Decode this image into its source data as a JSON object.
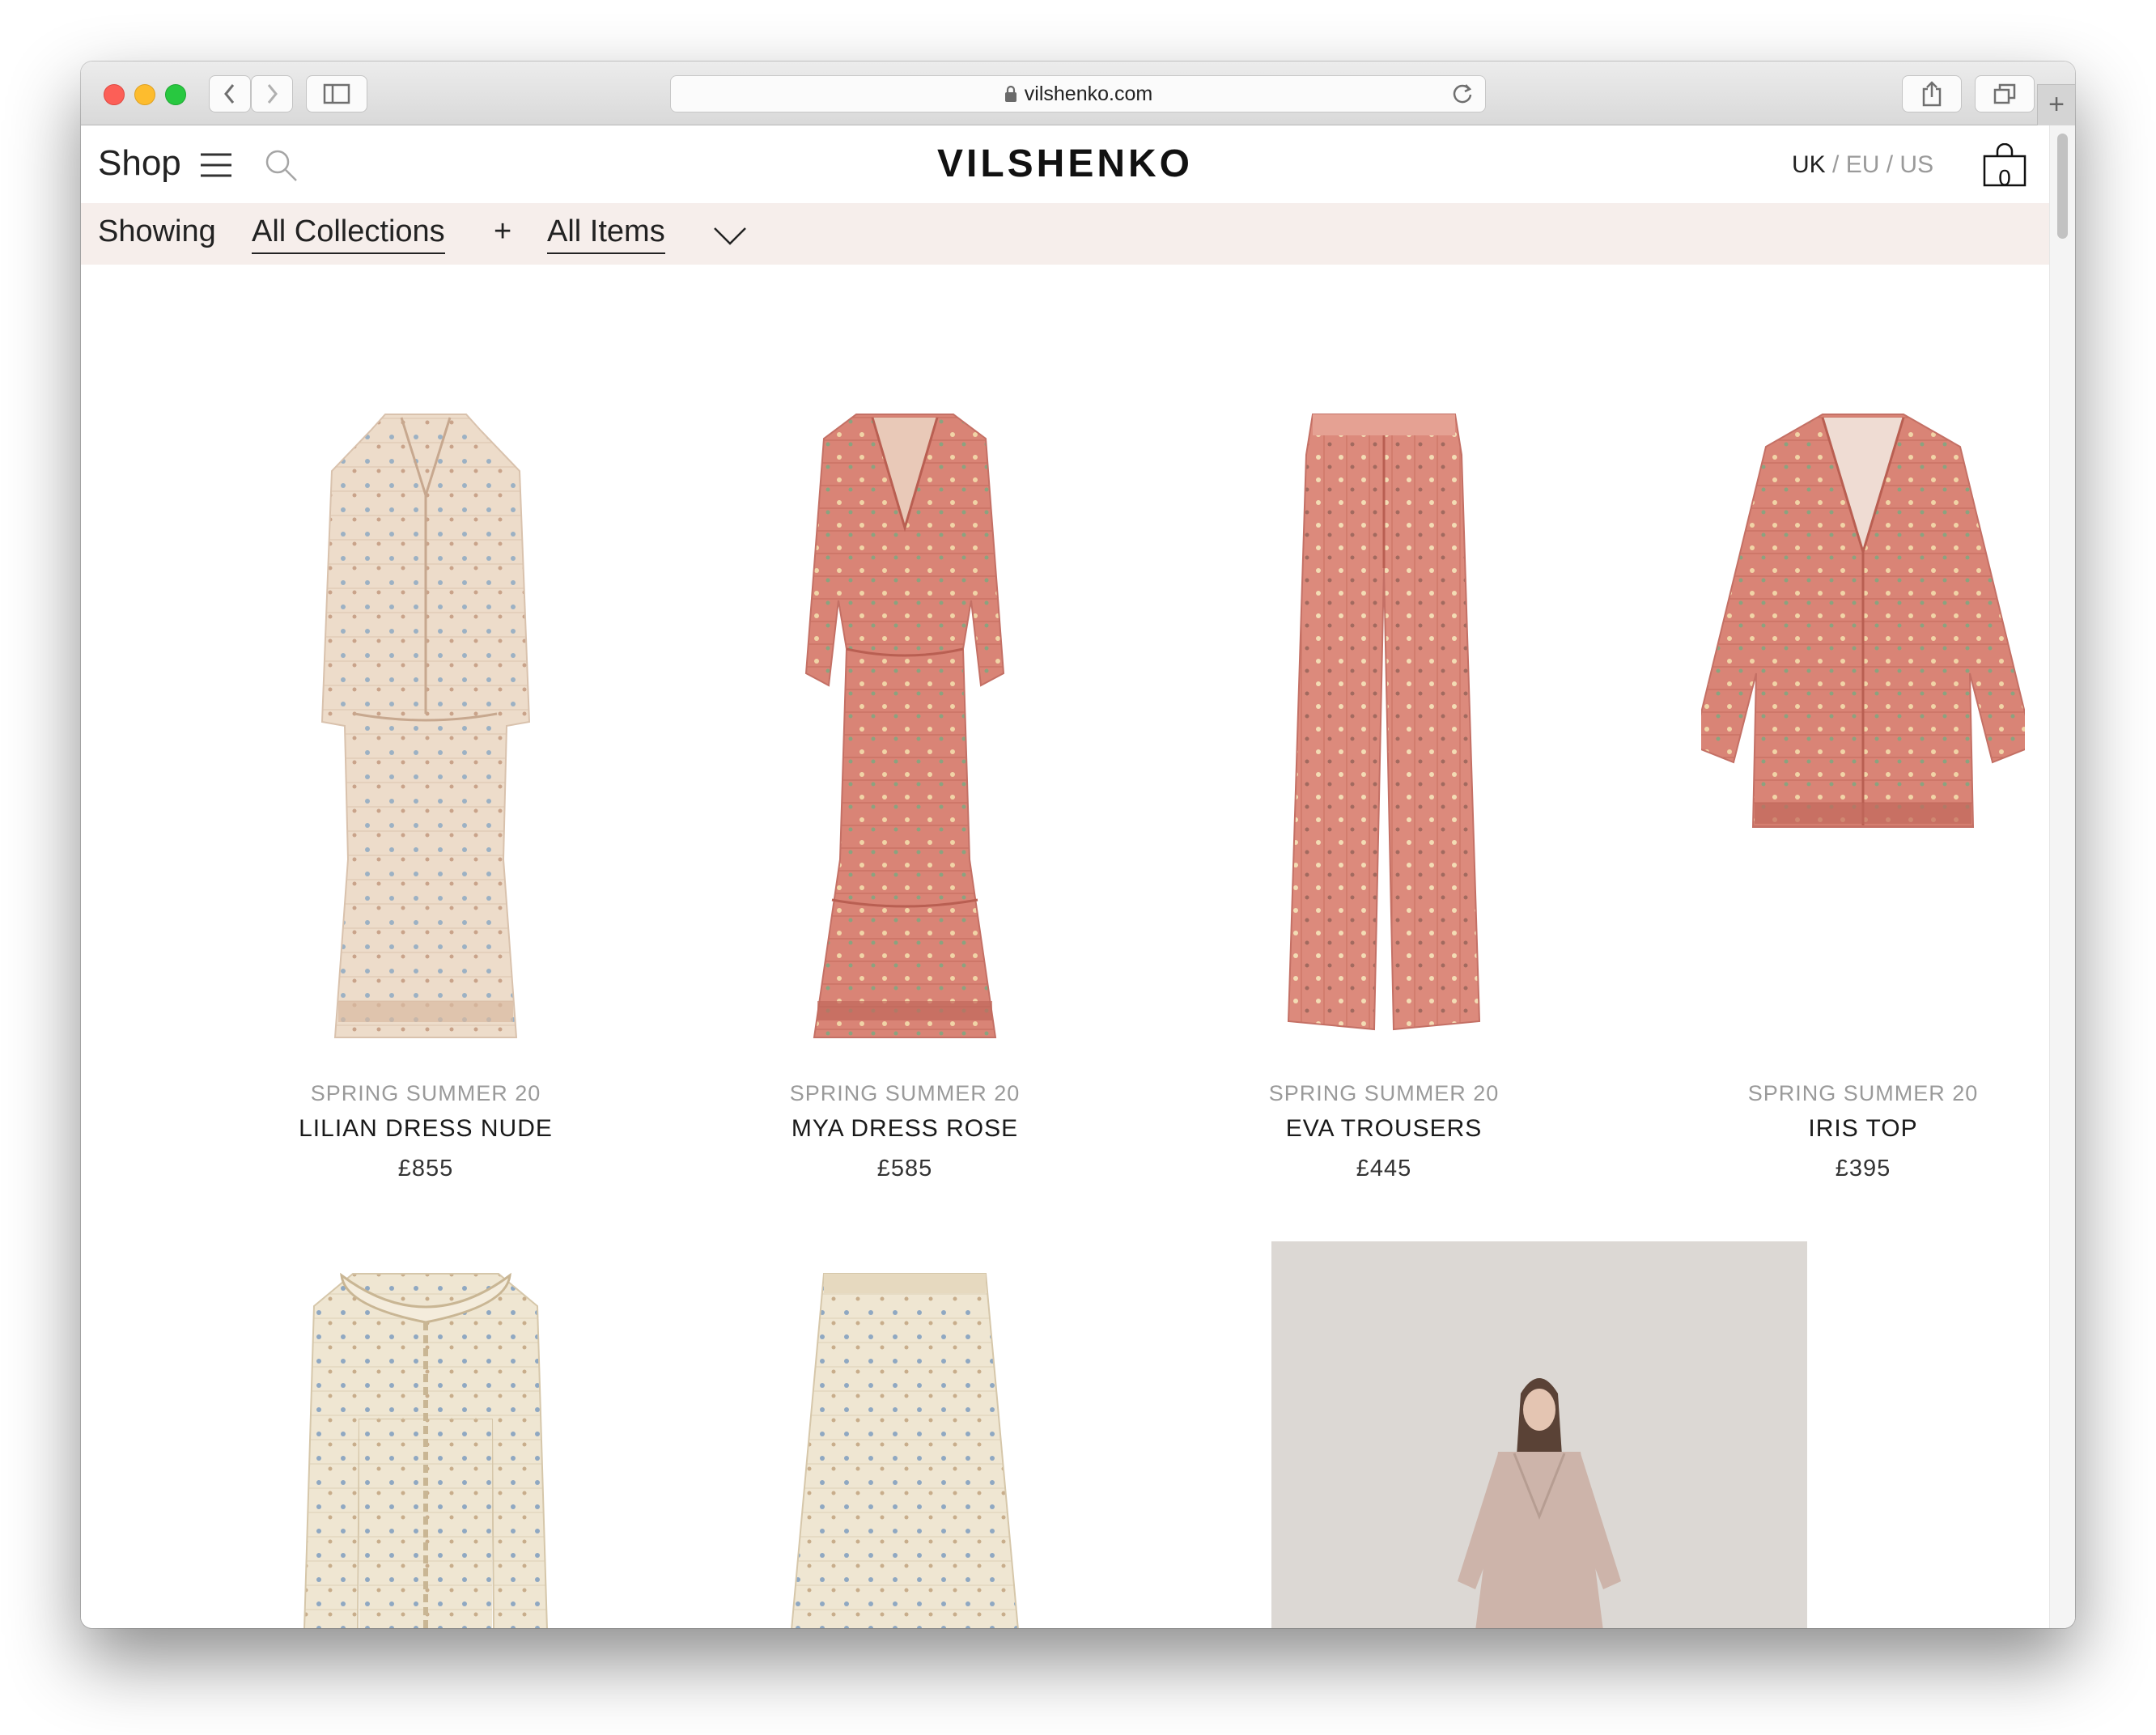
{
  "browser": {
    "url": "vilshenko.com",
    "new_tab_glyph": "+"
  },
  "header": {
    "shop_label": "Shop",
    "logo": "VILSHENKO",
    "regions": [
      "UK",
      "EU",
      "US"
    ],
    "region_separator": " / ",
    "active_region": "UK",
    "cart_count": "0"
  },
  "filter": {
    "showing_label": "Showing",
    "collection": "All Collections",
    "joiner": "+",
    "items": "All Items"
  },
  "products": [
    {
      "collection": "SPRING SUMMER 20",
      "name": "LILIAN DRESS NUDE",
      "price": "£855"
    },
    {
      "collection": "SPRING SUMMER 20",
      "name": "MYA DRESS ROSE",
      "price": "£585"
    },
    {
      "collection": "SPRING SUMMER 20",
      "name": "EVA TROUSERS",
      "price": "£445"
    },
    {
      "collection": "SPRING SUMMER 20",
      "name": "IRIS TOP",
      "price": "£395"
    }
  ],
  "colors": {
    "filter_bar_bg": "#f6eeeb",
    "print_nude": "#eddcca",
    "print_rose": "#d98476",
    "print_cream": "#efe6d2",
    "muted_text": "#9a9a9a"
  }
}
